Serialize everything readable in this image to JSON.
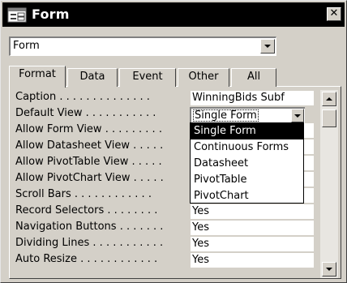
{
  "window": {
    "title": "Form",
    "close_label": "✕",
    "title_icon": "form-icon"
  },
  "object_selector": {
    "value": "Form"
  },
  "tabs": [
    {
      "label": "Format",
      "active": true
    },
    {
      "label": "Data",
      "active": false
    },
    {
      "label": "Event",
      "active": false
    },
    {
      "label": "Other",
      "active": false
    },
    {
      "label": "All",
      "active": false
    }
  ],
  "properties": [
    {
      "label": "Caption . . . . . . . . . . . . . .",
      "value": "WinningBids Subf"
    },
    {
      "label": "Default View . . . . . . . . . . .",
      "value": "Single Form"
    },
    {
      "label": "Allow Form View . . . . . . . . .",
      "value": ""
    },
    {
      "label": "Allow Datasheet View . . . . .",
      "value": ""
    },
    {
      "label": "Allow PivotTable View . . . . .",
      "value": ""
    },
    {
      "label": "Allow PivotChart View . . . . .",
      "value": ""
    },
    {
      "label": "Scroll Bars . . . . . . . . . . . .",
      "value": ""
    },
    {
      "label": "Record Selectors . . . . . . . .",
      "value": "Yes"
    },
    {
      "label": "Navigation Buttons . . . . . . .",
      "value": "Yes"
    },
    {
      "label": "Dividing Lines . . . . . . . . . . .",
      "value": "Yes"
    },
    {
      "label": "Auto Resize . . . . . . . . . . . .",
      "value": "Yes"
    }
  ],
  "default_view_dropdown": {
    "selected": "Single Form",
    "options": [
      "Single Form",
      "Continuous Forms",
      "Datasheet",
      "PivotTable",
      "PivotChart"
    ]
  },
  "colors": {
    "titlebar": "#000000",
    "highlight": "#000000",
    "window_bg": "#d4d0c8"
  }
}
